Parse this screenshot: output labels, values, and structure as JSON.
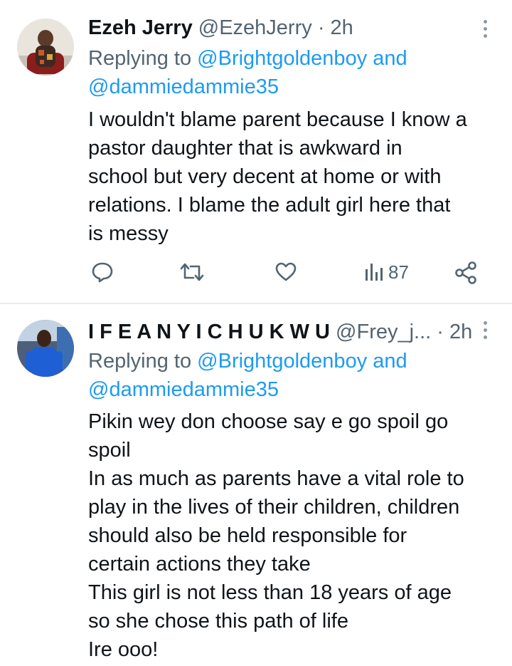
{
  "tweets": [
    {
      "name": "Ezeh Jerry",
      "handle": "@EzehJerry",
      "separator": "·",
      "time": "2h",
      "replying_prefix": "Replying to",
      "replying_to_1": "@Brightgoldenboy",
      "replying_and": "and",
      "replying_to_2": "@dammiedammie35",
      "body_lines": [
        "I wouldn't blame parent because I know a",
        "pastor daughter that is awkward in",
        "school but very decent at home or with",
        "relations. I blame the adult girl here that",
        "is messy"
      ],
      "actions": {
        "reply_icon": "reply-icon",
        "retweet_icon": "retweet-icon",
        "like_icon": "heart-icon",
        "views_icon": "views-icon",
        "views_count": "87",
        "share_icon": "share-icon"
      }
    },
    {
      "name": "I F E A N Y I C H U K W U",
      "handle": "@Frey_j...",
      "separator": "·",
      "time": "2h",
      "replying_prefix": "Replying to",
      "replying_to_1": "@Brightgoldenboy",
      "replying_and": "and",
      "replying_to_2": "@dammiedammie35",
      "body_lines": [
        "Pikin wey don choose say e go spoil go",
        "spoil",
        "In as much as parents have a vital role to",
        "play in the lives of their children, children",
        "should also be held responsible for",
        "certain actions they take",
        "This girl is not less than 18 years of age",
        "so she chose this path of life",
        "Ire ooo!"
      ]
    }
  ],
  "colors": {
    "text": "#0f1419",
    "secondary": "#536471",
    "link": "#1d9bf0",
    "divider": "#e6ecf0"
  }
}
